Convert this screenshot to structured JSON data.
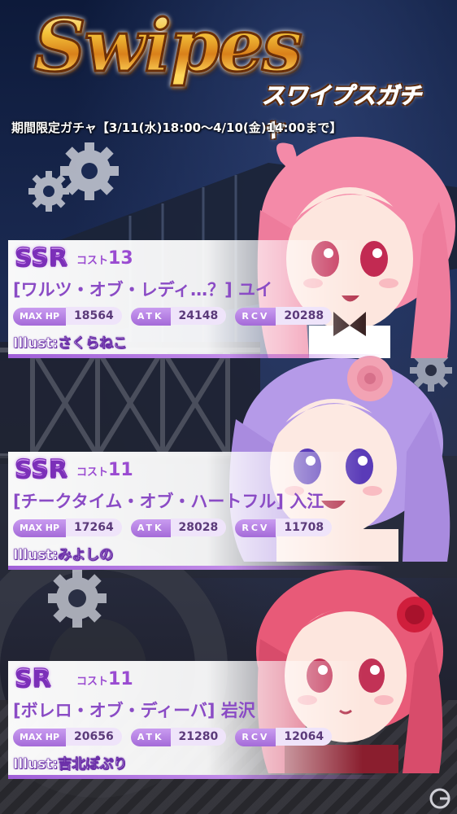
{
  "banner": {
    "title": "Swipes",
    "subtitle": "スワイプスガチャ",
    "period": "期間限定ガチャ【3/11(水)18:00～4/10(金)14:00まで】"
  },
  "stat_labels": {
    "hp": "MAX HP",
    "atk": "ATK",
    "rcv": "RCV"
  },
  "cards": [
    {
      "rarity": "SSR",
      "cost_label": "コスト",
      "cost": "13",
      "name": "[ワルツ・オブ・レディ…？] ユイ",
      "max_hp": "18564",
      "atk": "24148",
      "rcv": "20288",
      "illust_label": "Illust:",
      "illustrator": "さくらねこ",
      "hair_color": "#f48aa8"
    },
    {
      "rarity": "SSR",
      "cost_label": "コスト",
      "cost": "11",
      "name": "[チークタイム・オブ・ハートフル] 入江",
      "max_hp": "17264",
      "atk": "28028",
      "rcv": "11708",
      "illust_label": "Illust:",
      "illustrator": "みよしの",
      "hair_color": "#b59ae8"
    },
    {
      "rarity": "SR",
      "cost_label": "コスト",
      "cost": "11",
      "name": "[ボレロ・オブ・ディーバ] 岩沢",
      "max_hp": "20656",
      "atk": "21280",
      "rcv": "12064",
      "illust_label": "Illust:",
      "illustrator": "吉北ぽぷり",
      "hair_color": "#e85a78"
    }
  ]
}
